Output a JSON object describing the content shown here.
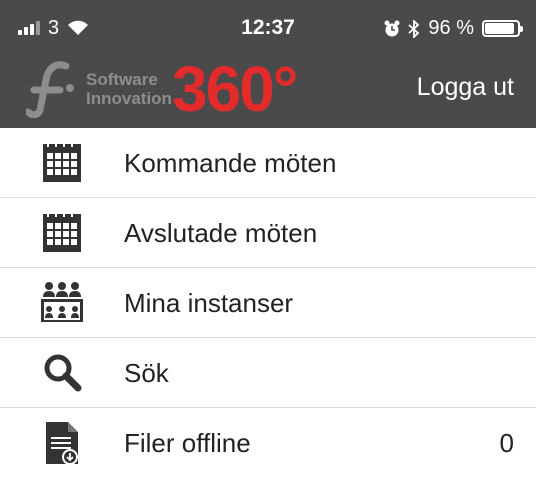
{
  "status_bar": {
    "carrier": "3",
    "time": "12:37",
    "battery": "96 %",
    "battery_level": 0.96
  },
  "header": {
    "logo_line1": "Software",
    "logo_line2": "Innovation",
    "logo_product": "360°",
    "logout_label": "Logga ut",
    "brand_color": "#e32b2b",
    "bar_color": "#4a4a4a"
  },
  "menu": {
    "items": [
      {
        "label": "Kommande möten",
        "icon": "calendar-icon"
      },
      {
        "label": "Avslutade möten",
        "icon": "calendar-icon"
      },
      {
        "label": "Mina instanser",
        "icon": "meeting-group-icon"
      },
      {
        "label": "Sök",
        "icon": "search-icon"
      },
      {
        "label": "Filer offline",
        "icon": "offline-file-icon",
        "count": "0"
      }
    ]
  }
}
